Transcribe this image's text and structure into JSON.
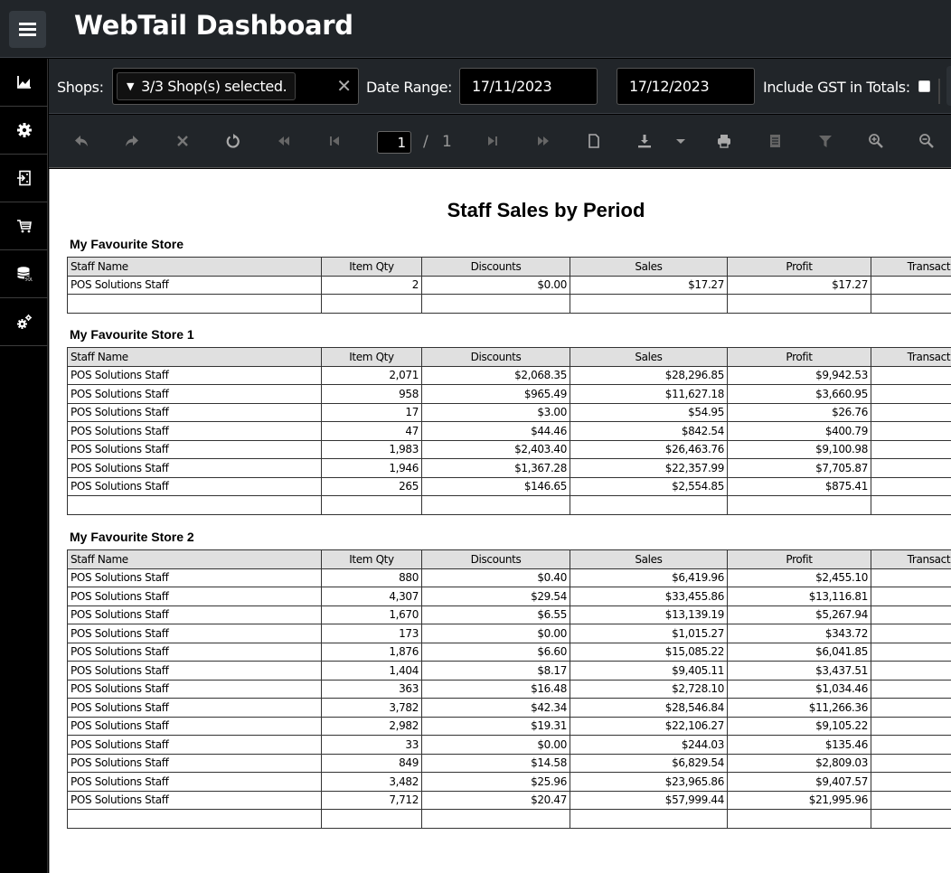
{
  "header": {
    "menu_icon": "hamburger-menu-icon",
    "title": "WebTail Dashboard"
  },
  "sidebar": {
    "items": [
      {
        "icon": "line-chart-icon",
        "label": "Reports"
      },
      {
        "icon": "gear-icon",
        "label": "Settings"
      },
      {
        "icon": "import-document-icon",
        "label": "Import"
      },
      {
        "icon": "cart-icon",
        "label": "Shop"
      },
      {
        "icon": "database-sql-icon",
        "label": "SQL"
      },
      {
        "icon": "gears-icon",
        "label": "Advanced Settings"
      }
    ]
  },
  "filters": {
    "shops_label": "Shops:",
    "shops_value": "3/3 Shop(s) selected.",
    "shops_clear": "✕",
    "date_range_label": "Date Range:",
    "date_from": "17/11/2023",
    "date_to": "17/12/2023",
    "gst_label": "Include GST in Totals:",
    "gst_checked": false
  },
  "toolbar": {
    "buttons": [
      "undo",
      "redo",
      "stop",
      "refresh",
      "first-page",
      "previous-page",
      "next-page",
      "last-page",
      "print-layout",
      "export",
      "export-menu",
      "print",
      "document-map",
      "parameters-filter",
      "zoom-in",
      "zoom-out"
    ],
    "current_page": "1",
    "page_separator": "/",
    "total_pages": "1"
  },
  "report": {
    "title": "Staff Sales by Period",
    "columns": [
      "Staff Name",
      "Item Qty",
      "Discounts",
      "Sales",
      "Profit",
      "Transactions"
    ],
    "stores": [
      {
        "name": "My Favourite Store",
        "rows": [
          [
            "POS Solutions Staff",
            "2",
            "$0.00",
            "$17.27",
            "$17.27",
            ""
          ]
        ]
      },
      {
        "name": "My Favourite Store 1",
        "rows": [
          [
            "POS Solutions Staff",
            "2,071",
            "$2,068.35",
            "$28,296.85",
            "$9,942.53",
            ""
          ],
          [
            "POS Solutions Staff",
            "958",
            "$965.49",
            "$11,627.18",
            "$3,660.95",
            ""
          ],
          [
            "POS Solutions Staff",
            "17",
            "$3.00",
            "$54.95",
            "$26.76",
            ""
          ],
          [
            "POS Solutions Staff",
            "47",
            "$44.46",
            "$842.54",
            "$400.79",
            ""
          ],
          [
            "POS Solutions Staff",
            "1,983",
            "$2,403.40",
            "$26,463.76",
            "$9,100.98",
            ""
          ],
          [
            "POS Solutions Staff",
            "1,946",
            "$1,367.28",
            "$22,357.99",
            "$7,705.87",
            ""
          ],
          [
            "POS Solutions Staff",
            "265",
            "$146.65",
            "$2,554.85",
            "$875.41",
            ""
          ]
        ]
      },
      {
        "name": "My Favourite Store 2",
        "rows": [
          [
            "POS Solutions Staff",
            "880",
            "$0.40",
            "$6,419.96",
            "$2,455.10",
            ""
          ],
          [
            "POS Solutions Staff",
            "4,307",
            "$29.54",
            "$33,455.86",
            "$13,116.81",
            ""
          ],
          [
            "POS Solutions Staff",
            "1,670",
            "$6.55",
            "$13,139.19",
            "$5,267.94",
            ""
          ],
          [
            "POS Solutions Staff",
            "173",
            "$0.00",
            "$1,015.27",
            "$343.72",
            ""
          ],
          [
            "POS Solutions Staff",
            "1,876",
            "$6.60",
            "$15,085.22",
            "$6,041.85",
            ""
          ],
          [
            "POS Solutions Staff",
            "1,404",
            "$8.17",
            "$9,405.11",
            "$3,437.51",
            ""
          ],
          [
            "POS Solutions Staff",
            "363",
            "$16.48",
            "$2,728.10",
            "$1,034.46",
            ""
          ],
          [
            "POS Solutions Staff",
            "3,782",
            "$42.34",
            "$28,546.84",
            "$11,266.36",
            ""
          ],
          [
            "POS Solutions Staff",
            "2,982",
            "$19.31",
            "$22,106.27",
            "$9,105.22",
            ""
          ],
          [
            "POS Solutions Staff",
            "33",
            "$0.00",
            "$244.03",
            "$135.46",
            ""
          ],
          [
            "POS Solutions Staff",
            "849",
            "$14.58",
            "$6,829.54",
            "$2,809.03",
            ""
          ],
          [
            "POS Solutions Staff",
            "3,482",
            "$25.96",
            "$23,965.86",
            "$9,407.57",
            ""
          ],
          [
            "POS Solutions Staff",
            "7,712",
            "$20.47",
            "$57,999.44",
            "$21,995.96",
            ""
          ]
        ]
      }
    ]
  }
}
